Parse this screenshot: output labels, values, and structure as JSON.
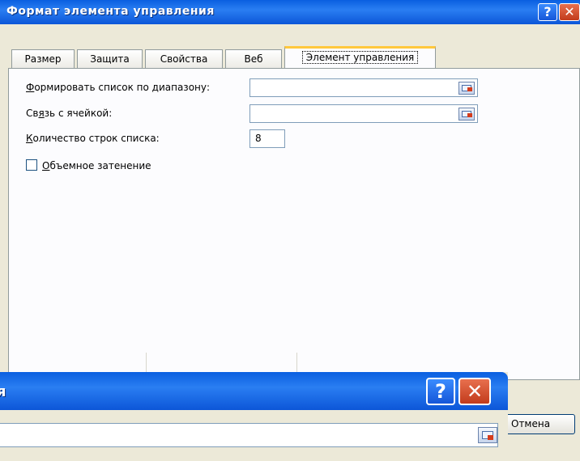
{
  "dialog": {
    "title": "Формат элемента управления",
    "help_glyph": "?",
    "close_glyph": "✕"
  },
  "tabs": [
    {
      "label": "Размер"
    },
    {
      "label": "Защита"
    },
    {
      "label": "Свойства"
    },
    {
      "label": "Веб"
    },
    {
      "label": "Элемент управления",
      "active": true
    }
  ],
  "control": {
    "range_label_u": "Ф",
    "range_label_rest": "ормировать список по диапазону:",
    "range_value": "",
    "link_label_pre": "Св",
    "link_label_u": "я",
    "link_label_rest": "зь с ячейкой:",
    "link_value": "",
    "rows_label_u": "К",
    "rows_label_rest": "оличество строк списка:",
    "rows_value": "8",
    "shading_label_u": "О",
    "shading_label_rest": "бъемное затенение",
    "shading_checked": false
  },
  "dialog2": {
    "title_fragment": "я",
    "help_glyph": "?",
    "close_glyph": "✕",
    "input_value": ""
  },
  "buttons": {
    "cancel": "Отмена"
  },
  "colors": {
    "titlebar": "#0a5fe0",
    "dialog_bg": "#ece9d8",
    "active_tab_highlight": "#ffc83c",
    "close_button": "#c23b1c"
  }
}
